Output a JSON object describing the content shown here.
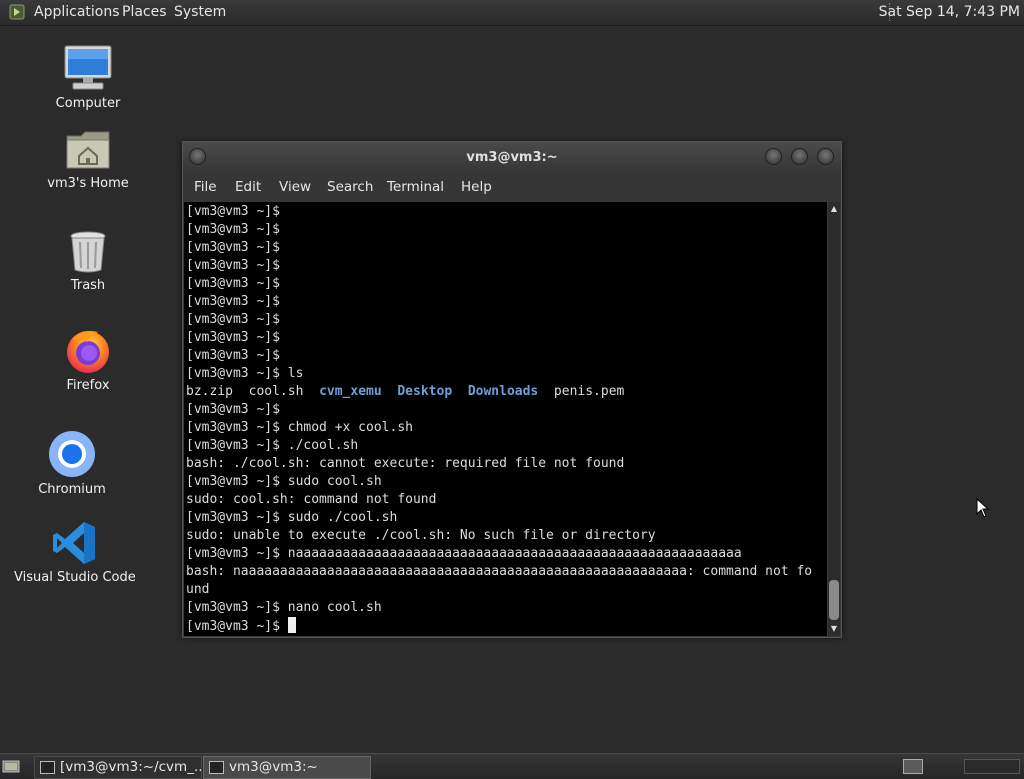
{
  "top_panel": {
    "menus": [
      "Applications",
      "Places",
      "System"
    ],
    "clock": "Sat Sep 14,  7:43 PM"
  },
  "desktop_icons": [
    {
      "label": "Computer",
      "icon": "computer-icon"
    },
    {
      "label": "vm3's Home",
      "icon": "home-folder-icon"
    },
    {
      "label": "Trash",
      "icon": "trash-icon"
    },
    {
      "label": "Firefox",
      "icon": "firefox-icon"
    },
    {
      "label": "Chromium",
      "icon": "chromium-icon"
    },
    {
      "label": "Visual Studio Code",
      "icon": "vscode-icon"
    }
  ],
  "terminal": {
    "title": "vm3@vm3:~",
    "menu": [
      "File",
      "Edit",
      "View",
      "Search",
      "Terminal",
      "Help"
    ],
    "lines": [
      "[vm3@vm3 ~]$",
      "[vm3@vm3 ~]$",
      "[vm3@vm3 ~]$",
      "[vm3@vm3 ~]$",
      "[vm3@vm3 ~]$",
      "[vm3@vm3 ~]$",
      "[vm3@vm3 ~]$",
      "[vm3@vm3 ~]$",
      "[vm3@vm3 ~]$",
      "[vm3@vm3 ~]$ ls",
      "LS_OUTPUT",
      "[vm3@vm3 ~]$",
      "[vm3@vm3 ~]$ chmod +x cool.sh",
      "[vm3@vm3 ~]$ ./cool.sh",
      "bash: ./cool.sh: cannot execute: required file not found",
      "[vm3@vm3 ~]$ sudo cool.sh",
      "sudo: cool.sh: command not found",
      "[vm3@vm3 ~]$ sudo ./cool.sh",
      "sudo: unable to execute ./cool.sh: No such file or directory",
      "[vm3@vm3 ~]$ naaaaaaaaaaaaaaaaaaaaaaaaaaaaaaaaaaaaaaaaaaaaaaaaaaaaaaaaa",
      "bash: naaaaaaaaaaaaaaaaaaaaaaaaaaaaaaaaaaaaaaaaaaaaaaaaaaaaaaaaa: command not fo",
      "und",
      "[vm3@vm3 ~]$ nano cool.sh",
      "[vm3@vm3 ~]$ "
    ],
    "ls_output": [
      {
        "name": "bz.zip",
        "dir": false
      },
      {
        "name": "cool.sh",
        "dir": false
      },
      {
        "name": "cvm_xemu",
        "dir": true
      },
      {
        "name": "Desktop",
        "dir": true
      },
      {
        "name": "Downloads",
        "dir": true
      },
      {
        "name": "penis.pem",
        "dir": false
      }
    ],
    "dir_color": "#6f9fd8"
  },
  "taskbar": {
    "tasks": [
      {
        "label": "[vm3@vm3:~/cvm_...",
        "active": false
      },
      {
        "label": "vm3@vm3:~",
        "active": true
      }
    ]
  }
}
